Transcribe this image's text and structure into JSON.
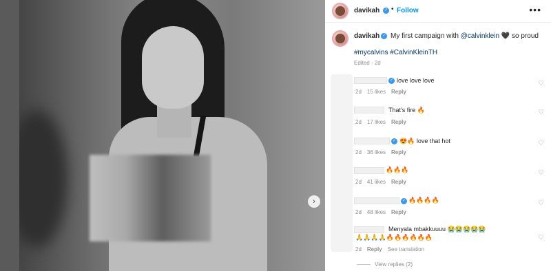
{
  "post": {
    "author": "davikah",
    "follow_label": "Follow",
    "separator": "•",
    "more_icon": "more-horizontal-icon",
    "next_icon": "chevron-right-icon"
  },
  "caption": {
    "username": "davikah",
    "text_before": "My first campaign with",
    "mention": "@calvinklein",
    "text_after": "so proud",
    "hashtags": "#mycalvins #CalvinKleinTH",
    "meta": "Edited · 2d"
  },
  "comments": [
    {
      "text": "love love love",
      "time": "2d",
      "likes": "15 likes",
      "reply": "Reply",
      "verified": true
    },
    {
      "text": "That's fire 🔥",
      "time": "2d",
      "likes": "17 likes",
      "reply": "Reply",
      "verified": false
    },
    {
      "text": "😍🔥 love that hot",
      "time": "2d",
      "likes": "36 likes",
      "reply": "Reply",
      "verified": true
    },
    {
      "text": "🔥🔥🔥",
      "time": "2d",
      "likes": "41 likes",
      "reply": "Reply",
      "verified": false
    },
    {
      "text": "🔥🔥🔥🔥",
      "time": "2d",
      "likes": "48 likes",
      "reply": "Reply",
      "verified": true
    },
    {
      "text": "Menyala mbakkuuuu 😭😭😭😭😭",
      "text2": "🙏🙏🙏🙏🔥🔥🔥🔥🔥🔥",
      "time": "2d",
      "likes": "",
      "reply": "Reply",
      "translate": "See translation",
      "verified": false
    }
  ],
  "view_replies": "View replies (2)",
  "colors": {
    "link": "#0095f6",
    "verified": "#3897f0",
    "muted": "#8e8e8e"
  }
}
